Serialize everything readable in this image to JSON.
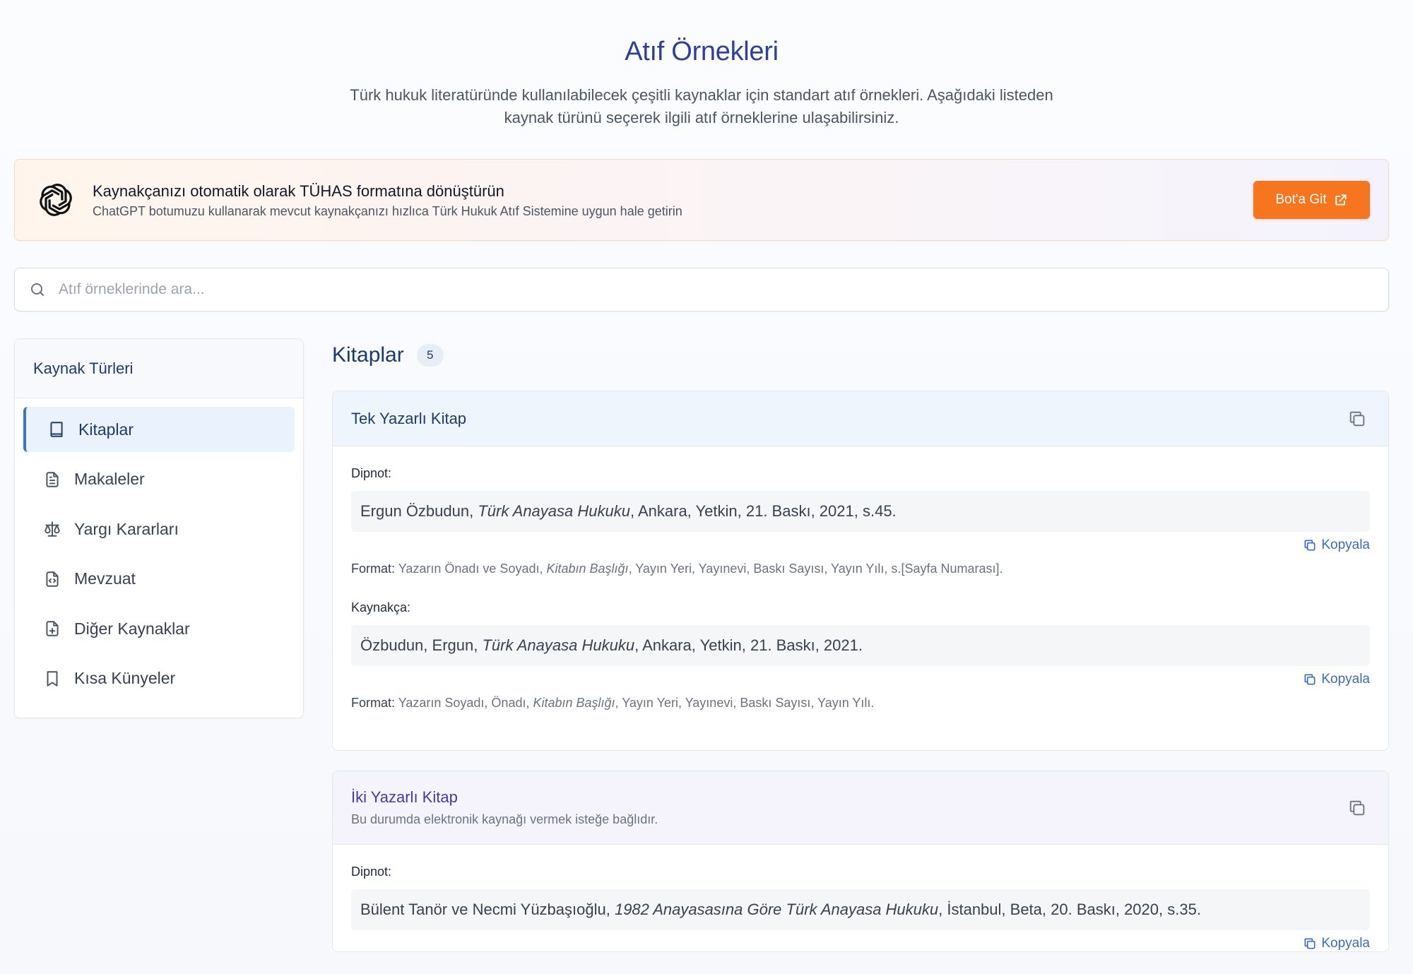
{
  "hero": {
    "title": "Atıf Örnekleri",
    "description": "Türk hukuk literatüründe kullanılabilecek çeşitli kaynaklar için standart atıf örnekleri. Aşağıdaki listeden kaynak türünü seçerek ilgili atıf örneklerine ulaşabilirsiniz."
  },
  "banner": {
    "title": "Kaynakçanızı otomatik olarak TÜHAS formatına dönüştürün",
    "subtitle": "ChatGPT botumuzu kullanarak mevcut kaynakçanızı hızlıca Türk Hukuk Atıf Sistemine uygun hale getirin",
    "button_label": "Bot'a Git",
    "button_color": "#f5761f",
    "logo_icon": "openai-icon"
  },
  "search": {
    "placeholder": "Atıf örneklerinde ara..."
  },
  "sidebar": {
    "title": "Kaynak Türleri",
    "items": [
      {
        "label": "Kitaplar",
        "icon": "book-icon",
        "active": true
      },
      {
        "label": "Makaleler",
        "icon": "document-icon"
      },
      {
        "label": "Yargı Kararları",
        "icon": "scale-icon"
      },
      {
        "label": "Mevzuat",
        "icon": "code-file-icon"
      },
      {
        "label": "Diğer Kaynaklar",
        "icon": "file-plus-icon"
      },
      {
        "label": "Kısa Künyeler",
        "icon": "bookmark-icon"
      }
    ]
  },
  "main": {
    "section_title": "Kitaplar",
    "count": "5",
    "cards": [
      {
        "title": "Tek Yazarlı Kitap",
        "footnote_label": "Dipnot:",
        "footnote_pre": "Ergun Özbudun, ",
        "footnote_italic": "Türk Anayasa Hukuku",
        "footnote_post": ", Ankara, Yetkin, 21. Baskı, 2021, s.45.",
        "copy_label": "Kopyala",
        "footnote_format_label": "Format:",
        "footnote_format_pre": " Yazarın Önadı ve Soyadı, ",
        "footnote_format_italic": "Kitabın Başlığı",
        "footnote_format_post": ", Yayın Yeri, Yayınevi, Baskı Sayısı, Yayın Yılı, s.[Sayfa Numarası].",
        "bib_label": "Kaynakça:",
        "bib_pre": "Özbudun, Ergun, ",
        "bib_italic": "Türk Anayasa Hukuku",
        "bib_post": ", Ankara, Yetkin, 21. Baskı, 2021.",
        "bib_format_label": "Format:",
        "bib_format_pre": " Yazarın Soyadı, Önadı, ",
        "bib_format_italic": "Kitabın Başlığı",
        "bib_format_post": ", Yayın Yeri, Yayınevi, Baskı Sayısı, Yayın Yılı."
      },
      {
        "title": "İki Yazarlı Kitap",
        "note": "Bu durumda elektronik kaynağı vermek isteğe bağlıdır.",
        "footnote_label": "Dipnot:",
        "footnote_pre": "Bülent Tanör ve Necmi Yüzbaşıoğlu, ",
        "footnote_italic": "1982 Anayasasına Göre Türk Anayasa Hukuku",
        "footnote_post": ", İstanbul, Beta, 20. Baskı, 2020, s.35.",
        "copy_label": "Kopyala"
      }
    ]
  }
}
